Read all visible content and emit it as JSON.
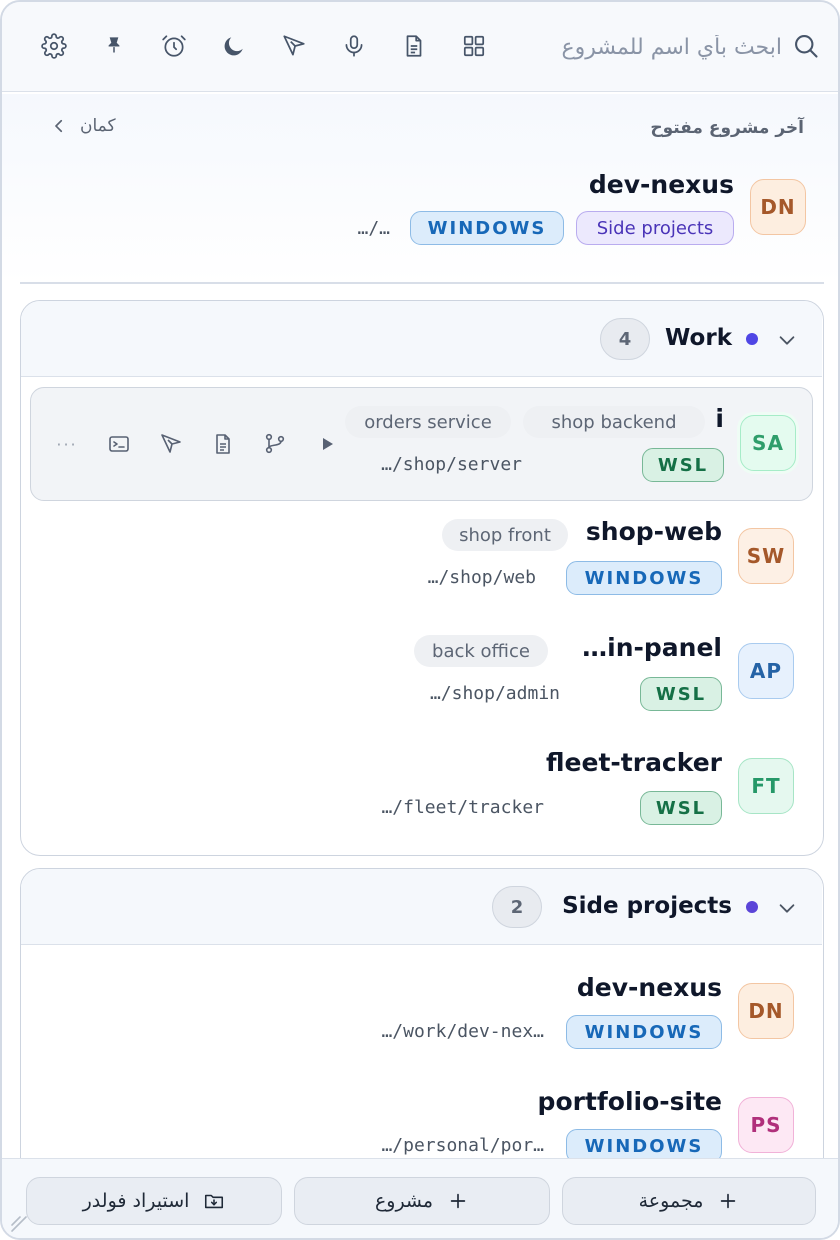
{
  "toolbar": {
    "search_placeholder": "ابحث بأي اسم للمشروع",
    "icons": [
      "search-icon",
      "grid-icon",
      "document-icon",
      "microphone-icon",
      "send-icon",
      "moon-icon",
      "alarm-clock-icon",
      "pin-icon",
      "gear-icon"
    ]
  },
  "recent": {
    "title": "آخر مشروع مفتوح",
    "more_label": "كمان",
    "project": {
      "initials": "DN",
      "name": "dev-nexus",
      "group_badge": "Side projects",
      "platform": "WINDOWS",
      "path": "…/…"
    }
  },
  "groups": [
    {
      "title": "Work",
      "count": "4",
      "projects": [
        {
          "initials": "SA",
          "name": "i",
          "tags": [
            "shop backend",
            "orders service"
          ],
          "platform": "WSL",
          "path": "…/shop/server"
        },
        {
          "initials": "SW",
          "name": "shop-web",
          "tags": [
            "shop front"
          ],
          "platform": "WINDOWS",
          "path": "…/shop/web"
        },
        {
          "initials": "AP",
          "name": "…in-panel",
          "tags": [
            "back office"
          ],
          "platform": "WSL",
          "path": "…/shop/admin"
        },
        {
          "initials": "FT",
          "name": "fleet-tracker",
          "tags": [],
          "platform": "WSL",
          "path": "…/fleet/tracker"
        }
      ]
    },
    {
      "title": "Side projects",
      "count": "2",
      "projects": [
        {
          "initials": "DN",
          "name": "dev-nexus",
          "tags": [],
          "platform": "WINDOWS",
          "path": "…/work/dev-nex…"
        },
        {
          "initials": "PS",
          "name": "portfolio-site",
          "tags": [],
          "platform": "WINDOWS",
          "path": "…/personal/por…"
        }
      ]
    }
  ],
  "row_actions": [
    "play-icon",
    "git-branch-icon",
    "document-icon",
    "send-icon",
    "terminal-icon",
    "more-icon"
  ],
  "row_actions_more": "···",
  "footer": {
    "new_group": "مجموعة",
    "new_project": "مشروع",
    "import_folder": "استيراد فولدر"
  },
  "colors": {
    "accent": "#4f46e5",
    "windows_badge": "#1768b8",
    "wsl_badge": "#157046"
  }
}
